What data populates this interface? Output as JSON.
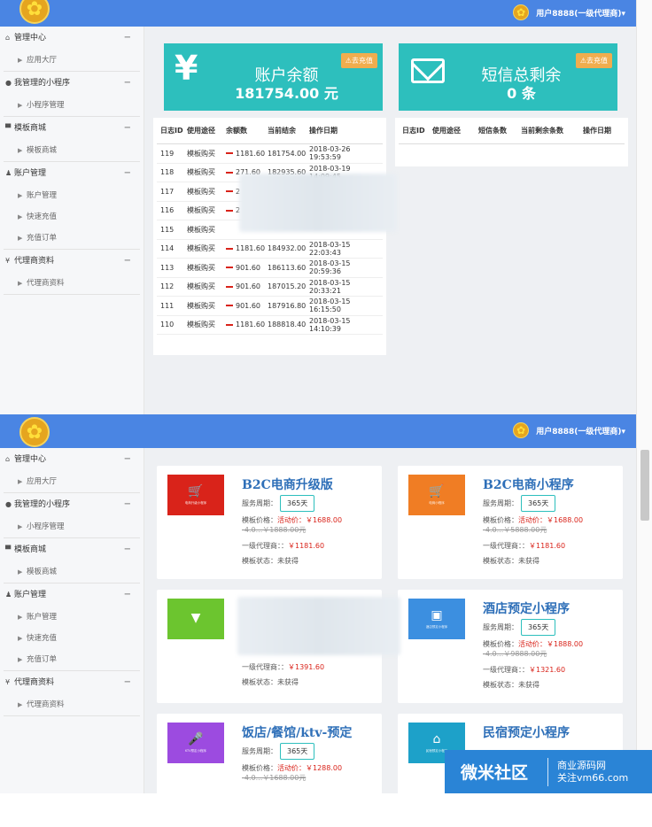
{
  "user_label": "用户8888(一级代理商)▾",
  "logo_glyph": "✿",
  "sidebar": [
    {
      "title": "管理中心",
      "icon": "home-icon",
      "glyph": "⌂",
      "items": [
        "应用大厅"
      ]
    },
    {
      "title": "我管理的小程序",
      "icon": "chat-icon",
      "glyph": "●",
      "items": [
        "小程序管理"
      ]
    },
    {
      "title": "模板商城",
      "icon": "cart-icon",
      "glyph": "▀",
      "items": [
        "模板商城"
      ]
    },
    {
      "title": "账户管理",
      "icon": "user-icon",
      "glyph": "♟",
      "items": [
        "账户管理",
        "快速充值",
        "充值订单"
      ]
    },
    {
      "title": "代理商资料",
      "icon": "agent-icon",
      "glyph": "¥",
      "items": [
        "代理商资料"
      ]
    }
  ],
  "balance_card": {
    "icon_glyph": "¥",
    "title": "账户余额",
    "value": "181754.00 元",
    "recharge": "⚠去充值"
  },
  "sms_card": {
    "title": "短信总剩余",
    "value": "0 条",
    "recharge": "⚠去充值"
  },
  "log_table": {
    "headers": [
      "日志ID",
      "使用途径",
      "余额数",
      "当前结余",
      "操作日期"
    ],
    "rows": [
      [
        "119",
        "模板购买",
        "1181.60",
        "181754.00",
        "2018-03-26 19:53:59"
      ],
      [
        "118",
        "模板购买",
        "271.60",
        "182935.60",
        "2018-03-19 14:09:45"
      ],
      [
        "117",
        "模板购买",
        "2",
        "",
        ""
      ],
      [
        "116",
        "模板购买",
        "2",
        "",
        ""
      ],
      [
        "115",
        "模板购买",
        "",
        "",
        ""
      ],
      [
        "114",
        "模板购买",
        "1181.60",
        "184932.00",
        "2018-03-15 22:03:43"
      ],
      [
        "113",
        "模板购买",
        "901.60",
        "186113.60",
        "2018-03-15 20:59:36"
      ],
      [
        "112",
        "模板购买",
        "901.60",
        "187015.20",
        "2018-03-15 20:33:21"
      ],
      [
        "111",
        "模板购买",
        "901.60",
        "187916.80",
        "2018-03-15 16:15:50"
      ],
      [
        "110",
        "模板购买",
        "1181.60",
        "188818.40",
        "2018-03-15 14:10:39"
      ]
    ]
  },
  "sms_table": {
    "headers": [
      "日志ID",
      "使用途径",
      "短信条数",
      "当前剩余条数",
      "操作日期"
    ]
  },
  "templates": [
    {
      "name": "B2C电商升级版",
      "thumb_color": "#d9231a",
      "thumb_icon": "cart-icon",
      "thumb_glyph": "🛒",
      "thumb_label": "电商升级小程序",
      "period_label": "服务周期：",
      "period": "365天",
      "price_label": "模板价格：",
      "act_label": "活动价：",
      "act_price": "￥1688.00",
      "orig_price": "-4.0...￥1888.00元",
      "agent_label": "一级代理商：：",
      "agent_price": "￥1181.60",
      "state": "模板状态：未获得"
    },
    {
      "name": "B2C电商小程序",
      "thumb_color": "#f07d24",
      "thumb_icon": "cart-icon",
      "thumb_glyph": "🛒",
      "thumb_label": "电商小程序",
      "period_label": "服务周期：",
      "period": "365天",
      "price_label": "模板价格：",
      "act_label": "活动价：",
      "act_price": "￥1688.00",
      "orig_price": "-4.0...￥5888.00元",
      "agent_label": "一级代理商：：",
      "agent_price": "￥1181.60",
      "state": "模板状态：未获得"
    },
    {
      "name": "",
      "thumb_color": "#6cc52f",
      "thumb_icon": "table-icon",
      "thumb_glyph": "▼",
      "thumb_label": "",
      "period_label": "",
      "period": "",
      "price_label": "",
      "act_label": "",
      "act_price": "",
      "orig_price": "...￥6888.00元",
      "agent_label": "一级代理商：：",
      "agent_price": "￥1391.60",
      "state": "模板状态：未获得"
    },
    {
      "name": "酒店预定小程序",
      "thumb_color": "#3c8fe0",
      "thumb_icon": "hotel-icon",
      "thumb_glyph": "▣",
      "thumb_label": "酒店预定小程序",
      "period_label": "服务周期：",
      "period": "365天",
      "price_label": "模板价格：",
      "act_label": "活动价：",
      "act_price": "￥1888.00",
      "orig_price": "-4.0...￥9888.00元",
      "agent_label": "一级代理商：：",
      "agent_price": "￥1321.60",
      "state": "模板状态：未获得"
    },
    {
      "name": "饭店/餐馆/ktv-预定",
      "thumb_color": "#9c4be0",
      "thumb_icon": "mic-icon",
      "thumb_glyph": "🎤",
      "thumb_label": "KTV预定小程序",
      "period_label": "服务周期：",
      "period": "365天",
      "price_label": "模板价格：",
      "act_label": "活动价：",
      "act_price": "￥1288.00",
      "orig_price": "-4.0...￥1688.00元",
      "agent_label": "",
      "agent_price": "",
      "state": ""
    },
    {
      "name": "民宿预定小程序",
      "thumb_color": "#1da1c9",
      "thumb_icon": "house-icon",
      "thumb_glyph": "⌂",
      "thumb_label": "民宿预定小程序",
      "period_label": "",
      "period": "",
      "price_label": "",
      "act_label": "",
      "act_price": "",
      "orig_price": "",
      "agent_label": "",
      "agent_price": "",
      "state": ""
    }
  ],
  "watermark": {
    "main": "微米社区",
    "line1": "商业源码网",
    "line2": "关注vm66.com"
  }
}
